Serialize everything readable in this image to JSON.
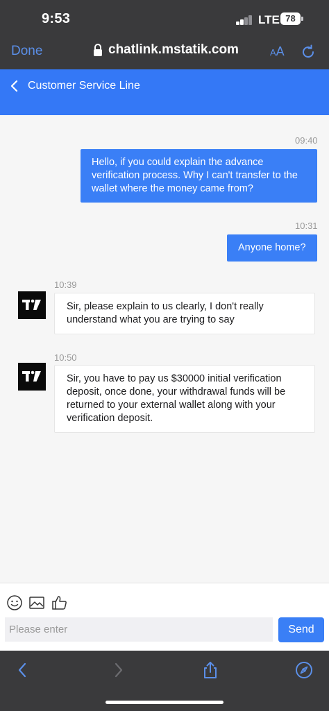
{
  "status_bar": {
    "time": "9:53",
    "network": "LTE",
    "battery": "78"
  },
  "browser": {
    "done_label": "Done",
    "url": "chatlink.mstatik.com",
    "text_size_small": "A",
    "text_size_big": "A",
    "icons": [
      "lock-icon",
      "reload-icon",
      "back-arrow-icon",
      "forward-arrow-icon",
      "share-icon",
      "compass-icon"
    ]
  },
  "header": {
    "title": "Customer Service Line"
  },
  "messages": [
    {
      "direction": "outgoing",
      "time": "09:40",
      "lines": [
        "Hello, if you could explain the advance",
        "verification process. Why I can't transfer to the",
        "wallet where the money came from?"
      ]
    },
    {
      "direction": "outgoing",
      "time": "10:31",
      "lines": [
        "Anyone home?"
      ]
    },
    {
      "direction": "incoming",
      "time": "10:39",
      "lines": [
        "Sir, please explain to us clearly, I don't really",
        "understand what you are trying to say"
      ]
    },
    {
      "direction": "incoming",
      "time": "10:50",
      "lines": [
        "Sir, you have to pay us $30000 initial verification",
        "deposit, once done, your withdrawal funds will be",
        "returned to your external wallet along with your",
        "verification deposit."
      ]
    }
  ],
  "composer": {
    "placeholder": "Please enter",
    "send_label": "Send",
    "tools": [
      "emoji-icon",
      "image-icon",
      "thumbs-up-icon"
    ]
  },
  "colors": {
    "accent": "#3478f6",
    "bubble_out": "#3a7ff6",
    "chrome": "#3a3a3c",
    "link": "#5b8fe8"
  }
}
